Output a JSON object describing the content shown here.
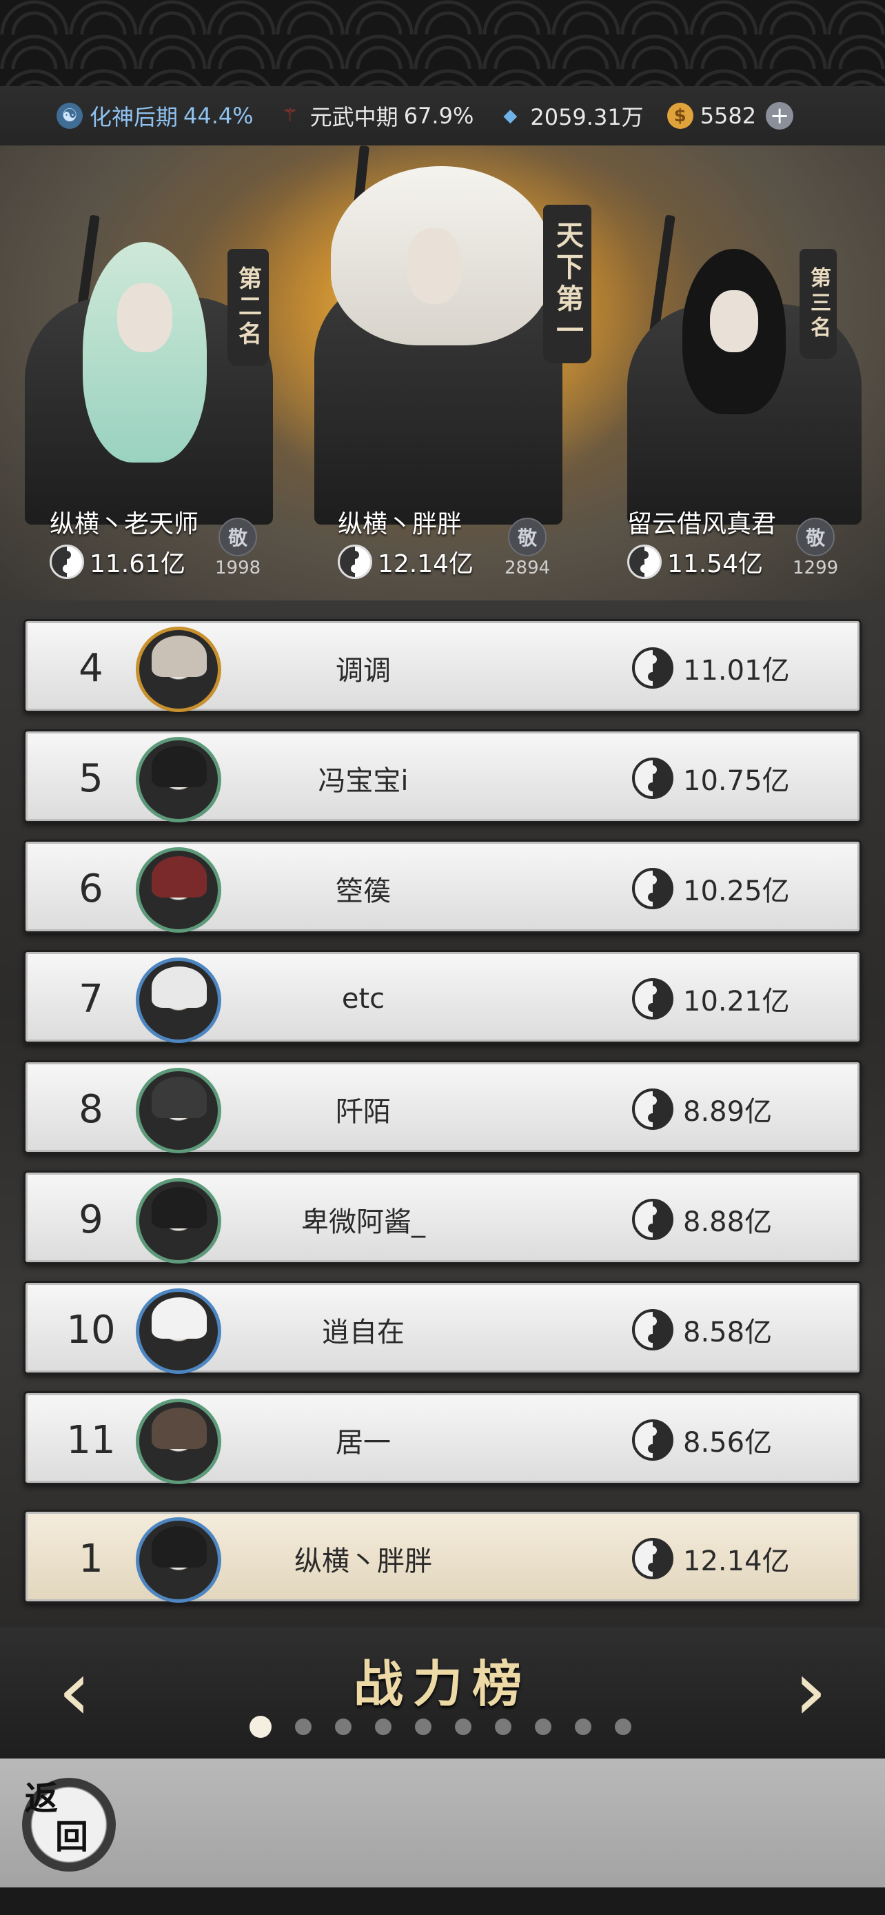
{
  "resources": {
    "realm1": {
      "label": "化神后期",
      "pct": "44.4%",
      "icon": "yin-yang-icon",
      "color": "#8fc2f0"
    },
    "realm2": {
      "label": "元武中期",
      "pct": "67.9%",
      "icon": "trident-icon",
      "color": "#c0392b"
    },
    "crystal": {
      "value": "2059.31万",
      "icon": "crystal-icon",
      "color": "#6fb3e8"
    },
    "coin": {
      "value": "5582",
      "icon": "coin-icon",
      "color": "#e0a23a"
    },
    "plus_label": "+"
  },
  "podium": {
    "first": {
      "banner": "天下第一",
      "name": "纵横丶胖胖",
      "power": "12.14亿",
      "respect": "敬",
      "respect_count": "2894"
    },
    "second": {
      "banner": "第二名",
      "name": "纵横丶老天师",
      "power": "11.61亿",
      "respect": "敬",
      "respect_count": "1998"
    },
    "third": {
      "banner": "第三名",
      "name": "留云借风真君",
      "power": "11.54亿",
      "respect": "敬",
      "respect_count": "1299"
    }
  },
  "ranking": [
    {
      "rank": "4",
      "name": "调调",
      "power": "11.01亿"
    },
    {
      "rank": "5",
      "name": "冯宝宝i",
      "power": "10.75亿"
    },
    {
      "rank": "6",
      "name": "箜篌",
      "power": "10.25亿"
    },
    {
      "rank": "7",
      "name": "etc",
      "power": "10.21亿"
    },
    {
      "rank": "8",
      "name": "阡陌",
      "power": "8.89亿"
    },
    {
      "rank": "9",
      "name": "卑微阿酱_",
      "power": "8.88亿"
    },
    {
      "rank": "10",
      "name": "逍自在",
      "power": "8.58亿"
    },
    {
      "rank": "11",
      "name": "居一",
      "power": "8.56亿"
    }
  ],
  "self_row": {
    "rank": "1",
    "name": "纵横丶胖胖",
    "power": "12.14亿"
  },
  "nav": {
    "title": "战力榜",
    "left_arrow": "‹",
    "right_arrow": "›",
    "page_count": 10,
    "active_page": 1
  },
  "back": {
    "char1": "返",
    "char2": "回"
  }
}
